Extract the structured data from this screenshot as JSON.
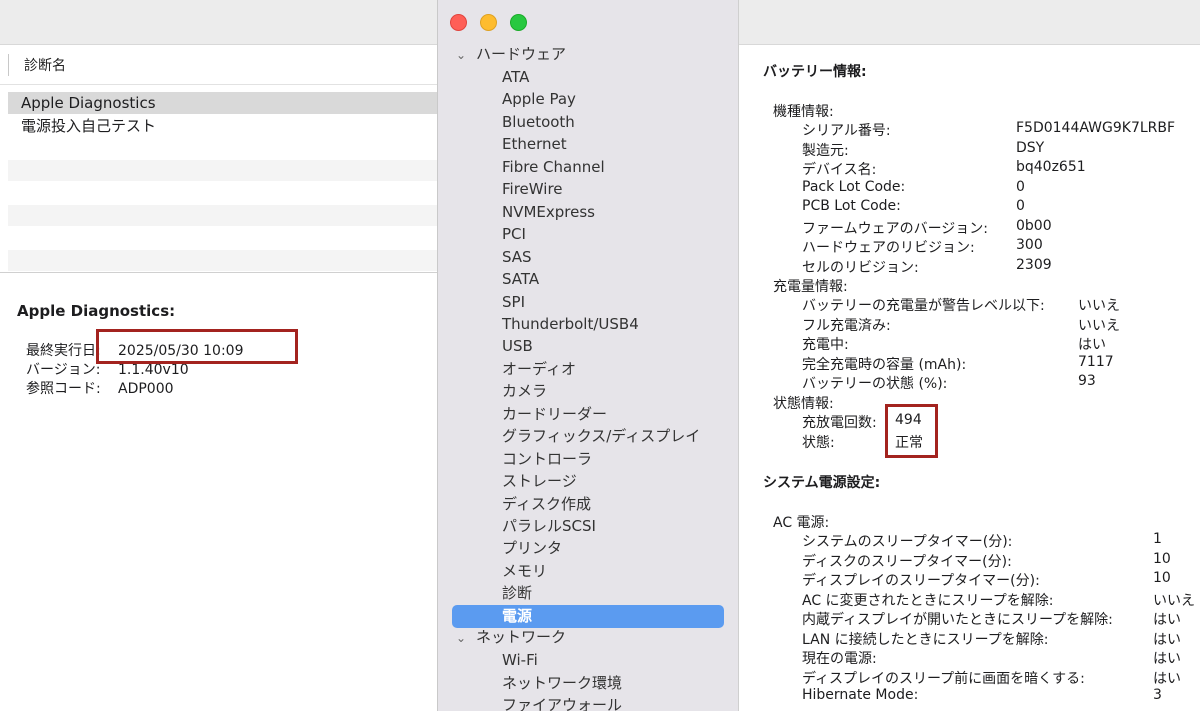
{
  "diagnostics": {
    "column_header": "診断名",
    "rows": [
      "Apple Diagnostics",
      "電源投入自己テスト"
    ],
    "detail": {
      "title": "Apple Diagnostics:",
      "fields": [
        {
          "label": "最終実行日:",
          "value": "2025/05/30 10:09"
        },
        {
          "label": "バージョン:",
          "value": "1.1.40v10"
        },
        {
          "label": "参照コード:",
          "value": "ADP000"
        }
      ]
    }
  },
  "sidebar": {
    "hardware_group": "ハードウェア",
    "hardware_items": [
      "ATA",
      "Apple Pay",
      "Bluetooth",
      "Ethernet",
      "Fibre Channel",
      "FireWire",
      "NVMExpress",
      "PCI",
      "SAS",
      "SATA",
      "SPI",
      "Thunderbolt/USB4",
      "USB",
      "オーディオ",
      "カメラ",
      "カードリーダー",
      "グラフィックス/ディスプレイ",
      "コントローラ",
      "ストレージ",
      "ディスク作成",
      "パラレルSCSI",
      "プリンタ",
      "メモリ",
      "診断",
      "電源"
    ],
    "selected_item": "電源",
    "network_group": "ネットワーク",
    "network_items": [
      "Wi-Fi",
      "ネットワーク環境",
      "ファイアウォール"
    ]
  },
  "content": {
    "battery_title": "バッテリー情報:",
    "model_group": "機種情報:",
    "model_rows": [
      {
        "k": "シリアル番号:",
        "v": "F5D0144AWG9K7LRBF"
      },
      {
        "k": "製造元:",
        "v": "DSY"
      },
      {
        "k": "デバイス名:",
        "v": "bq40z651"
      },
      {
        "k": "Pack Lot Code:",
        "v": "0"
      },
      {
        "k": "PCB Lot Code:",
        "v": "0"
      },
      {
        "k": "ファームウェアのバージョン:",
        "v": "0b00"
      },
      {
        "k": "ハードウェアのリビジョン:",
        "v": "300"
      },
      {
        "k": "セルのリビジョン:",
        "v": "2309"
      }
    ],
    "charge_group": "充電量情報:",
    "charge_rows": [
      {
        "k": "バッテリーの充電量が警告レベル以下:",
        "v": "いいえ"
      },
      {
        "k": "フル充電済み:",
        "v": "いいえ"
      },
      {
        "k": "充電中:",
        "v": "はい"
      },
      {
        "k": "完全充電時の容量 (mAh):",
        "v": "7117"
      },
      {
        "k": "バッテリーの状態 (%):",
        "v": "93"
      }
    ],
    "status_group": "状態情報:",
    "status_rows": [
      {
        "k": "充放電回数:",
        "v": "494"
      },
      {
        "k": "状態:",
        "v": "正常"
      }
    ],
    "power_title": "システム電源設定:",
    "ac_group": "AC 電源:",
    "ac_rows": [
      {
        "k": "システムのスリープタイマー(分):",
        "v": "1"
      },
      {
        "k": "ディスクのスリープタイマー(分):",
        "v": "10"
      },
      {
        "k": "ディスプレイのスリープタイマー(分):",
        "v": "10"
      },
      {
        "k": "AC に変更されたときにスリープを解除:",
        "v": "いいえ"
      },
      {
        "k": "内蔵ディスプレイが開いたときにスリープを解除:",
        "v": "はい"
      },
      {
        "k": "LAN に接続したときにスリープを解除:",
        "v": "はい"
      },
      {
        "k": "現在の電源:",
        "v": "はい"
      },
      {
        "k": "ディスプレイのスリープ前に画面を暗くする:",
        "v": "はい"
      },
      {
        "k": "Hibernate Mode:",
        "v": "3"
      }
    ]
  }
}
